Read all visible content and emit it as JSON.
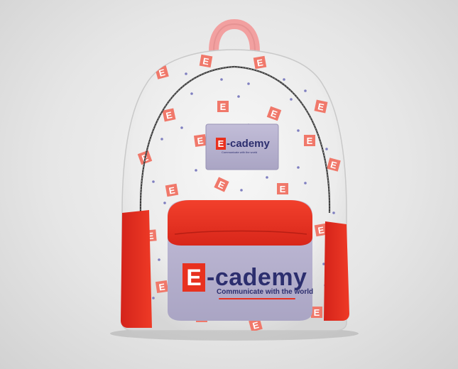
{
  "product": {
    "name": "backpack mockup",
    "colors": {
      "body": "#efefef",
      "accent_red": "#e8311f",
      "handle_pink": "#f2a0a0",
      "patch_lavender": "#b8b3cf",
      "text_navy": "#2c2e6e",
      "pattern_tile": "#f0786a",
      "dot": "#7f7fc0"
    }
  },
  "pattern": {
    "tile_letter": "E"
  },
  "front_patch": {
    "logo_letter": "E",
    "brand_suffix": "-cademy",
    "tagline": "Communicate with the world"
  },
  "small_patch": {
    "logo_letter": "E",
    "brand_suffix": "-cademy",
    "tagline": "Communicate with the world"
  }
}
